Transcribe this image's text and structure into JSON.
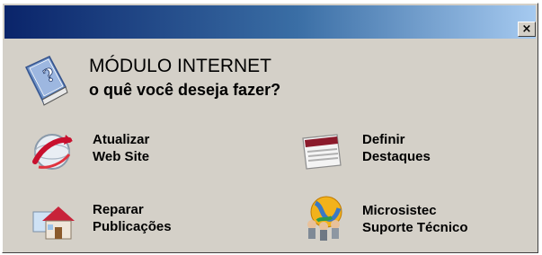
{
  "window": {
    "close_label": "×"
  },
  "header": {
    "title": "MÓDULO INTERNET",
    "subtitle": "o quê você deseja fazer?",
    "icon": "help-book-icon"
  },
  "actions": [
    {
      "line1": "Atualizar",
      "line2": "Web Site",
      "icon": "refresh-globe-icon"
    },
    {
      "line1": "Definir",
      "line2": "Destaques",
      "icon": "document-icon"
    },
    {
      "line1": "Reparar",
      "line2": "Publicações",
      "icon": "house-repair-icon"
    },
    {
      "line1": "Microsistec",
      "line2": "Suporte Técnico",
      "icon": "support-team-icon"
    }
  ],
  "colors": {
    "dialog_background": "#d4d0c8",
    "titlebar_start": "#0a246a",
    "titlebar_end": "#a6caf0"
  }
}
